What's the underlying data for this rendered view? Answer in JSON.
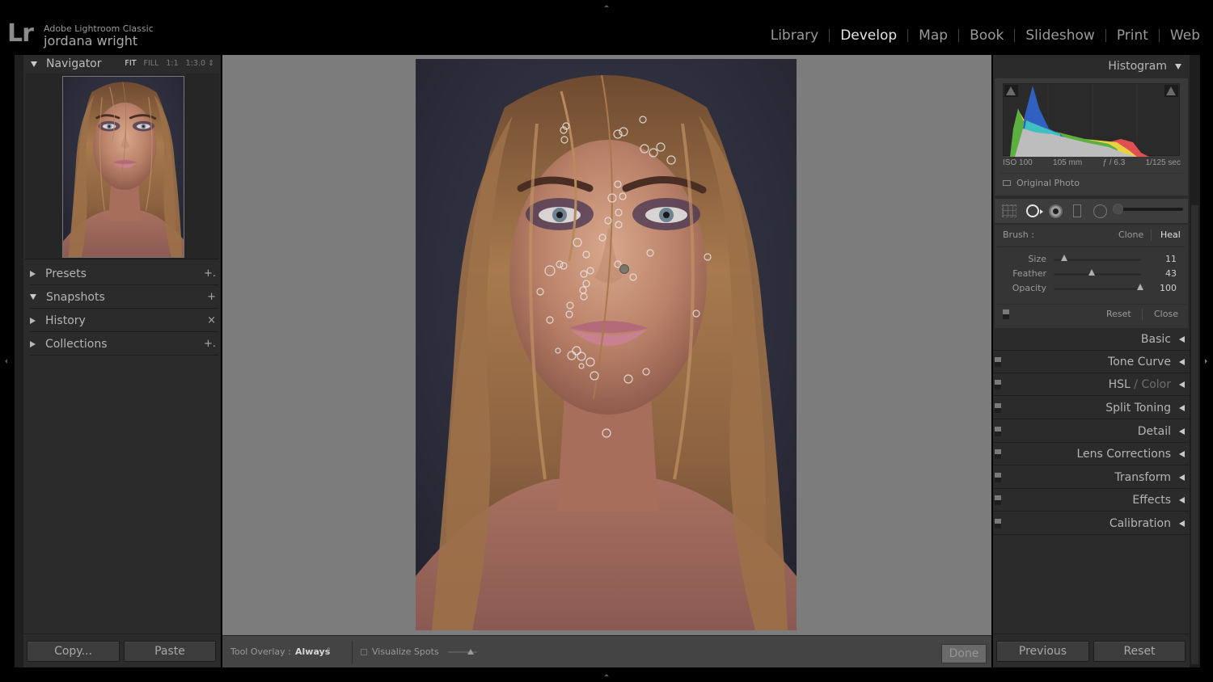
{
  "identity": {
    "logo": "Lr",
    "app_name": "Adobe Lightroom Classic",
    "user_name": "jordana wright"
  },
  "modules": [
    {
      "label": "Library",
      "active": false
    },
    {
      "label": "Develop",
      "active": true
    },
    {
      "label": "Map",
      "active": false
    },
    {
      "label": "Book",
      "active": false
    },
    {
      "label": "Slideshow",
      "active": false
    },
    {
      "label": "Print",
      "active": false
    },
    {
      "label": "Web",
      "active": false
    }
  ],
  "left_panel": {
    "navigator": {
      "title": "Navigator",
      "zoom_options": [
        "FIT",
        "FILL",
        "1:1",
        "1:3.0 ⇕"
      ],
      "active_zoom": "FIT"
    },
    "sections": [
      {
        "label": "Presets",
        "expanded": false,
        "action": "+."
      },
      {
        "label": "Snapshots",
        "expanded": true,
        "action": "+"
      },
      {
        "label": "History",
        "expanded": false,
        "action": "×"
      },
      {
        "label": "Collections",
        "expanded": false,
        "action": "+."
      }
    ],
    "copy_label": "Copy...",
    "paste_label": "Paste"
  },
  "toolbar": {
    "tool_overlay_label": "Tool Overlay :",
    "tool_overlay_value": "Always",
    "updown": "⇕",
    "visualize_spots_label": "Visualize Spots",
    "visualize_spots_checked": false,
    "visualize_threshold": 0.75,
    "done_label": "Done"
  },
  "right_panel": {
    "histogram": {
      "title": "Histogram",
      "exif": {
        "iso": "ISO 100",
        "focal": "105 mm",
        "aperture": "ƒ / 6.3",
        "shutter": "1/125 sec"
      },
      "original_photo_label": "Original Photo"
    },
    "spot_removal": {
      "brush_label": "Brush :",
      "clone_label": "Clone",
      "heal_label": "Heal",
      "active_mode": "Heal",
      "params": [
        {
          "label": "Size",
          "value": "11",
          "fraction": 0.11
        },
        {
          "label": "Feather",
          "value": "43",
          "fraction": 0.43
        },
        {
          "label": "Opacity",
          "value": "100",
          "fraction": 1.0
        }
      ],
      "reset_label": "Reset",
      "close_label": "Close"
    },
    "sections": [
      {
        "label": "Basic",
        "has_toggle": false
      },
      {
        "label": "Tone Curve",
        "has_toggle": true
      },
      {
        "label": "HSL",
        "suffix": " / Color",
        "has_toggle": true
      },
      {
        "label": "Split Toning",
        "has_toggle": true
      },
      {
        "label": "Detail",
        "has_toggle": true
      },
      {
        "label": "Lens Corrections",
        "has_toggle": true
      },
      {
        "label": "Transform",
        "has_toggle": true
      },
      {
        "label": "Effects",
        "has_toggle": true
      },
      {
        "label": "Calibration",
        "has_toggle": true
      }
    ],
    "previous_label": "Previous",
    "reset_label": "Reset"
  },
  "photo": {
    "description": "Portrait of woman with wet blonde hair",
    "spot_count": 47,
    "selected_spot_count": 1
  },
  "colors": {
    "active_text": "#e6e6e6",
    "panel_bg": "#2b2b2b",
    "canvas_bg": "#7c7c7c",
    "toolbar_bg": "#444444"
  }
}
